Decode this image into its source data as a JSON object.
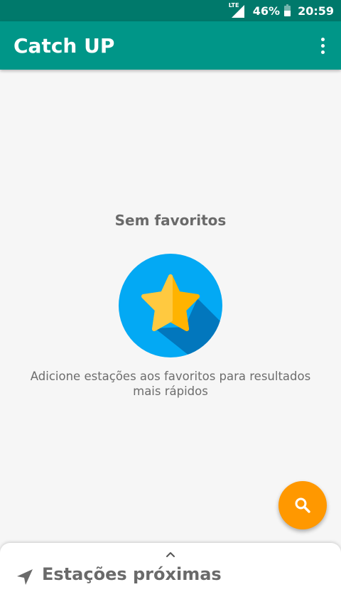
{
  "status_bar": {
    "network": "LTE",
    "battery_percent": "46%",
    "time": "20:59",
    "battery_level": 0.46
  },
  "app_bar": {
    "title": "Catch UP",
    "menu_icon": "more-vert-icon",
    "color": "#009688"
  },
  "empty_state": {
    "title": "Sem favoritos",
    "icon": "star-icon",
    "message": "Adicione estações aos favoritos para resultados mais rápidos",
    "circle_color": "#03a9f4",
    "star_color": "#ffc107"
  },
  "fab": {
    "icon": "search-icon",
    "color": "#ff9800"
  },
  "bottom_sheet": {
    "handle_icon": "chevron-up-icon",
    "nav_icon": "navigation-arrow-icon",
    "title": "Estações próximas"
  }
}
